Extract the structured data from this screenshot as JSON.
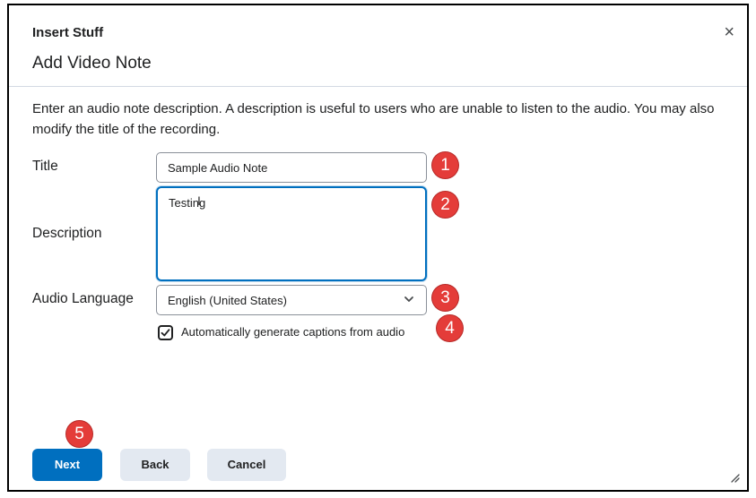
{
  "dialog": {
    "header": "Insert Stuff",
    "close_symbol": "×",
    "title": "Add Video Note",
    "description": "Enter an audio note description. A description is useful to users who are unable to listen to the audio. You may also modify the title of the recording."
  },
  "form": {
    "title_label": "Title",
    "title_value": "Sample Audio Note",
    "description_label": "Description",
    "description_value": "Testing",
    "language_label": "Audio Language",
    "language_value": "English (United States)",
    "captions_label": "Automatically generate captions from audio",
    "captions_checked": true
  },
  "buttons": {
    "next": "Next",
    "back": "Back",
    "cancel": "Cancel"
  },
  "callouts": [
    "1",
    "2",
    "3",
    "4",
    "5"
  ],
  "icons": {
    "close": "close-icon",
    "chevron": "chevron-down-icon",
    "check": "check-icon",
    "resize": "resize-handle-icon",
    "text_cursor": "text-cursor-icon"
  },
  "colors": {
    "primary": "#006fbf",
    "secondary": "#e3e9f1",
    "callout": "#e43c39"
  }
}
